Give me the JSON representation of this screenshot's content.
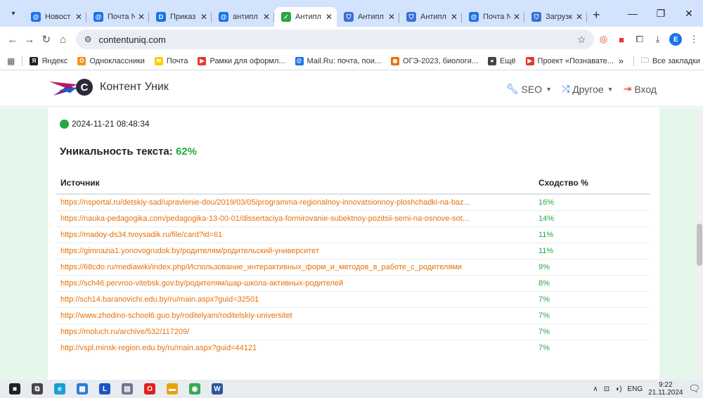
{
  "browser": {
    "tabs": [
      {
        "title": "Новост",
        "favicon": "mail-ru-icon",
        "color": "#1a73e8",
        "glyph": "@"
      },
      {
        "title": "Почта N",
        "favicon": "mail-ru-icon",
        "color": "#1a73e8",
        "glyph": "@"
      },
      {
        "title": "Приказ",
        "favicon": "doc-icon",
        "color": "#1a73e8",
        "glyph": "D"
      },
      {
        "title": "антипл",
        "favicon": "mail-ru-icon",
        "color": "#1a73e8",
        "glyph": "@"
      },
      {
        "title": "Антипл",
        "favicon": "check-icon",
        "color": "#28a745",
        "glyph": "✓",
        "active": true
      },
      {
        "title": "Антипл",
        "favicon": "shield-icon",
        "color": "#3d6fd6",
        "glyph": "⛉"
      },
      {
        "title": "Антипл",
        "favicon": "shield-icon",
        "color": "#3d6fd6",
        "glyph": "⛉"
      },
      {
        "title": "Почта N",
        "favicon": "mail-ru-icon",
        "color": "#1a73e8",
        "glyph": "@"
      },
      {
        "title": "Загрузк",
        "favicon": "shield-icon",
        "color": "#3d6fd6",
        "glyph": "⛉"
      }
    ],
    "url": "contentuniq.com",
    "profile_letter": "E",
    "bookmarks": [
      {
        "label": "Яндекс",
        "color": "#222",
        "glyph": "Я"
      },
      {
        "label": "Одноклассники",
        "color": "#f7931e",
        "glyph": "О"
      },
      {
        "label": "Почта",
        "color": "#ffcc00",
        "glyph": "✉"
      },
      {
        "label": "Рамки для оформл...",
        "color": "#e53935",
        "glyph": "▶"
      },
      {
        "label": "Mail.Ru: почта, пои...",
        "color": "#1a73e8",
        "glyph": "@"
      },
      {
        "label": "ОГЭ-2023, биологи...",
        "color": "#e8700a",
        "glyph": "◉"
      },
      {
        "label": "Ещё",
        "color": "#444",
        "glyph": "●"
      },
      {
        "label": "Проект «Познавате...",
        "color": "#e53935",
        "glyph": "▶"
      }
    ],
    "bookmarks_more": "»",
    "all_bookmarks": "Все закладки"
  },
  "site": {
    "name": "Контент Уник",
    "nav": {
      "seo": "SEO",
      "other": "Другое",
      "login": "Вход"
    }
  },
  "report": {
    "timestamp": "2024-11-21 08:48:34",
    "uniqueness_label": "Уникальность текста:",
    "uniqueness_value": "62%",
    "col_source": "Источник",
    "col_similarity": "Сходство %",
    "rows": [
      {
        "url": "https://nsportal.ru/detskiy-sad/upravlenie-dou/2019/03/05/programma-regionalnoy-innovatsionnoy-ploshchadki-na-baz...",
        "sim": "16%"
      },
      {
        "url": "https://nauka-pedagogika.com/pedagogika-13-00-01/dissertaciya-formirovanie-subektnoy-pozitsii-semi-na-osnove-sot...",
        "sim": "14%"
      },
      {
        "url": "https://madoy-ds34.tvoysadik.ru/file/card?id=61",
        "sim": "11%"
      },
      {
        "url": "https://gimnazia1.yonovogrudok.by/родителям/родительский-университет",
        "sim": "11%"
      },
      {
        "url": "https://68cdo.ru/mediawiki/index.php/Использование_интерактивных_форм_и_методов_в_работе_с_родителями",
        "sim": "9%"
      },
      {
        "url": "https://sch46.pervroo-vitebsk.gov.by/родителям/шар-школа-активных-родителей",
        "sim": "8%"
      },
      {
        "url": "http://sch14.baranovichi.edu.by/ru/main.aspx?guid=32501",
        "sim": "7%"
      },
      {
        "url": "http://www.zhodino-school6.guo.by/roditelyam/roditelskiy-universitet",
        "sim": "7%"
      },
      {
        "url": "https://moluch.ru/archive/532/117209/",
        "sim": "7%"
      },
      {
        "url": "http://vspl.minsk-region.edu.by/ru/main.aspx?guid=44121",
        "sim": "7%"
      }
    ]
  },
  "taskbar": {
    "apps": [
      {
        "name": "start-icon",
        "glyph": "■",
        "color": "#222"
      },
      {
        "name": "task-view-icon",
        "glyph": "⧉",
        "color": "#444"
      },
      {
        "name": "edge-icon",
        "glyph": "e",
        "color": "#1a9fd6"
      },
      {
        "name": "store-icon",
        "glyph": "▦",
        "color": "#2b7bd6"
      },
      {
        "name": "l-app-icon",
        "glyph": "L",
        "color": "#1a56c4"
      },
      {
        "name": "calculator-icon",
        "glyph": "▤",
        "color": "#6b7a8a"
      },
      {
        "name": "opera-icon",
        "glyph": "O",
        "color": "#e0201b"
      },
      {
        "name": "explorer-icon",
        "glyph": "▬",
        "color": "#e8a40c"
      },
      {
        "name": "chrome-icon",
        "glyph": "◉",
        "color": "#34a853"
      },
      {
        "name": "word-icon",
        "glyph": "W",
        "color": "#2b579a"
      }
    ],
    "lang": "ENG",
    "time": "9:22",
    "date": "21.11.2024"
  },
  "colors": {
    "accent_green": "#28a745",
    "link_orange": "#e8700a",
    "page_bg": "#e5f6ea"
  }
}
